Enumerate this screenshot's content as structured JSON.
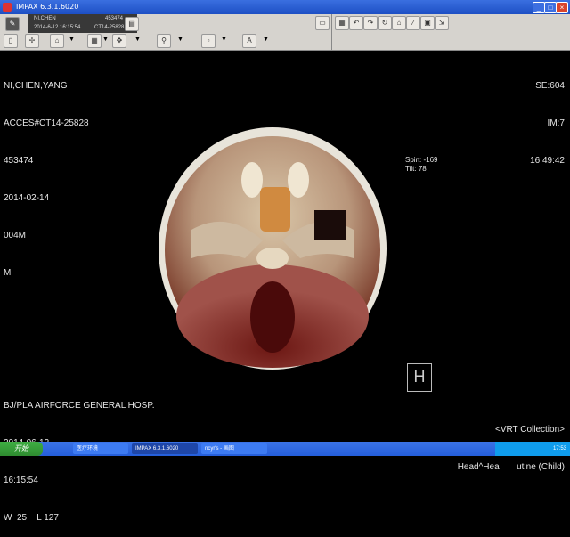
{
  "window": {
    "title": "IMPAX 6.3.1.6020"
  },
  "patient_box": {
    "name": "NI,CHEN",
    "id": "453474",
    "datetime": "2014-6-12 16:15:54",
    "accession": "CT14-25828"
  },
  "overlay": {
    "top_left": [
      "NI,CHEN,YANG",
      "ACCES#CT14-25828",
      "453474",
      "2014-02-14",
      "004M",
      "M"
    ],
    "top_right": [
      "SE:604",
      "IM:7",
      "16:49:42"
    ],
    "spin": "Spin: -169",
    "tilt": "Tilt:  78",
    "bottom_left": [
      "BJ/PLA AIRFORCE GENERAL HOSP.",
      "2014-06-12",
      "16:15:54",
      "W  25    L 127"
    ],
    "bottom_right": [
      "<VRT Collection>",
      "Head^Hea       utine (Child)"
    ],
    "orientation_marker": "H"
  },
  "taskbar": {
    "start": "开始",
    "tasks": [
      "医疗环境",
      "IMPAX 6.3.1.6020",
      "ncyr's - 画图"
    ],
    "clock": "17:53"
  },
  "colors": {
    "titlebar": "#1d4fc4",
    "toolbar": "#d6d3ce",
    "close": "#d9452c",
    "taskbar": "#245edb"
  }
}
